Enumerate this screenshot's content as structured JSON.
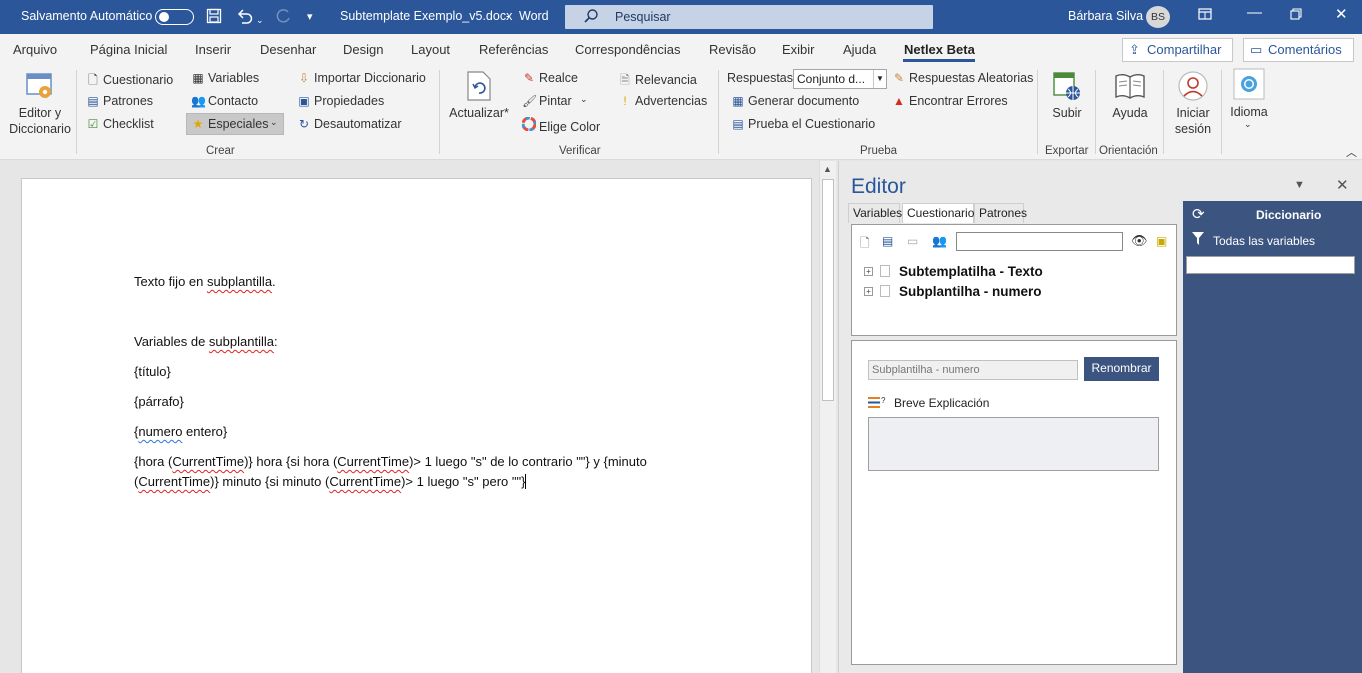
{
  "titlebar": {
    "autosave_label": "Salvamento Automático",
    "doc_title": "Subtemplate Exemplo_v5.docx",
    "dash": "-",
    "app_name": "Word",
    "search_placeholder": "Pesquisar",
    "user_name": "Bárbara Silva",
    "user_initials": "BS"
  },
  "ribbon_tabs": [
    "Arquivo",
    "Página Inicial",
    "Inserir",
    "Desenhar",
    "Design",
    "Layout",
    "Referências",
    "Correspondências",
    "Revisão",
    "Exibir",
    "Ajuda",
    "Netlex Beta"
  ],
  "share_label": "Compartilhar",
  "comments_label": "Comentários",
  "ribbon": {
    "editor_label_1": "Editor y",
    "editor_label_2": "Diccionario",
    "crear": {
      "col1": [
        "Cuestionario",
        "Patrones",
        "Checklist"
      ],
      "col2": [
        "Variables",
        "Contacto",
        "Especiales"
      ],
      "col3": [
        "Importar Diccionario",
        "Propiedades",
        "Desautomatizar"
      ],
      "group_label": "Crear"
    },
    "verificar": {
      "actualizar": "Actualizar*",
      "col1": [
        "Realce",
        "Pintar",
        "Elige Color"
      ],
      "col2": [
        "Relevancia",
        "Advertencias"
      ],
      "group_label": "Verificar"
    },
    "prueba": {
      "respuestas_label": "Respuestas:",
      "respuestas_value": "Conjunto d...",
      "generar": "Generar documento",
      "prueba_cuestionario": "Prueba el Cuestionario",
      "respuestas_aleatorias": "Respuestas Aleatorias",
      "encontrar_errores": "Encontrar Errores",
      "group_label": "Prueba"
    },
    "exportar": {
      "subir": "Subir",
      "group_label": "Exportar"
    },
    "orientacion": {
      "ayuda": "Ayuda",
      "group_label": "Orientación"
    },
    "iniciar_1": "Iniciar",
    "iniciar_2": "sesión",
    "idioma": "Idioma"
  },
  "document": {
    "line1": "Texto fijo en ",
    "line1_sq": "subplantilla",
    "line1_end": ".",
    "line2": "Variables de ",
    "line2_sq": "subplantilla",
    "line2_end": ":",
    "line3": "{título}",
    "line4": "{párrafo}",
    "line5_open": "{",
    "line5_sq": "numero",
    "line5_end": " entero}",
    "line6_a": "{hora (",
    "ct": "CurrentTime",
    "line6_b": ")} hora {si hora (",
    "line6_c": ")> 1 luego \"s\" de lo contrario \"\"} y {minuto",
    "line7_a": "(",
    "line7_b": ")} minuto {si minuto (",
    "line7_c": ")> 1 luego \"s\" pero \"\"}"
  },
  "editor": {
    "title": "Editor",
    "tabs": [
      "Variables",
      "Cuestionario",
      "Patrones"
    ],
    "tree_items": [
      "Subtemplatilha - Texto",
      "Subplantilha - numero"
    ],
    "name_value": "Subplantilha - numero",
    "rename_label": "Renombrar",
    "brief_label": "Breve Explicación"
  },
  "dictionary": {
    "title": "Diccionario",
    "filter_label": "Todas las variables"
  },
  "colors": {
    "accent": "#2b579a",
    "dict_bg": "#3c5580"
  }
}
